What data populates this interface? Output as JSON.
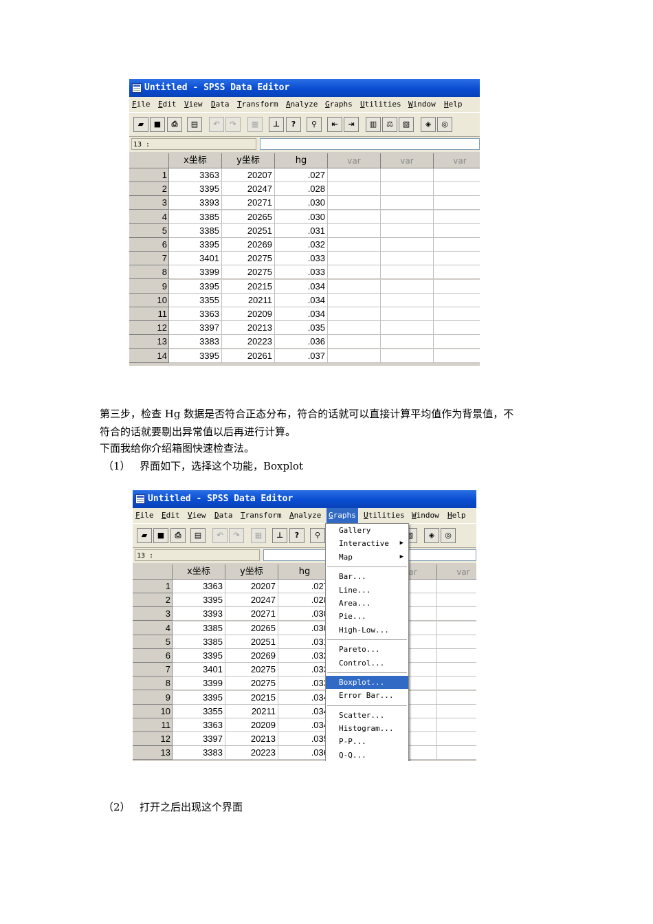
{
  "window": {
    "title": "Untitled - SPSS Data Editor"
  },
  "menu": [
    "File",
    "Edit",
    "View",
    "Data",
    "Transform",
    "Analyze",
    "Graphs",
    "Utilities",
    "Window",
    "Help"
  ],
  "cell_ref": "13 :",
  "columns": [
    "x坐标",
    "y坐标",
    "hg",
    "var",
    "var",
    "var"
  ],
  "rows": [
    [
      "1",
      "3363",
      "20207",
      ".027"
    ],
    [
      "2",
      "3395",
      "20247",
      ".028"
    ],
    [
      "3",
      "3393",
      "20271",
      ".030"
    ],
    [
      "4",
      "3385",
      "20265",
      ".030"
    ],
    [
      "5",
      "3385",
      "20251",
      ".031"
    ],
    [
      "6",
      "3395",
      "20269",
      ".032"
    ],
    [
      "7",
      "3401",
      "20275",
      ".033"
    ],
    [
      "8",
      "3399",
      "20275",
      ".033"
    ],
    [
      "9",
      "3395",
      "20215",
      ".034"
    ],
    [
      "10",
      "3355",
      "20211",
      ".034"
    ],
    [
      "11",
      "3363",
      "20209",
      ".034"
    ],
    [
      "12",
      "3397",
      "20213",
      ".035"
    ],
    [
      "13",
      "3383",
      "20223",
      ".036"
    ],
    [
      "14",
      "3395",
      "20261",
      ".037"
    ]
  ],
  "graphs_menu": [
    {
      "label": "Gallery"
    },
    {
      "label": "Interactive",
      "submenu": true
    },
    {
      "label": "Map",
      "submenu": true
    },
    {
      "separator": true
    },
    {
      "label": "Bar..."
    },
    {
      "label": "Line..."
    },
    {
      "label": "Area..."
    },
    {
      "label": "Pie..."
    },
    {
      "label": "High-Low..."
    },
    {
      "separator": true
    },
    {
      "label": "Pareto..."
    },
    {
      "label": "Control..."
    },
    {
      "separator": true
    },
    {
      "label": "Boxplot...",
      "selected": true
    },
    {
      "label": "Error Bar..."
    },
    {
      "separator": true
    },
    {
      "label": "Scatter..."
    },
    {
      "label": "Histogram..."
    },
    {
      "label": "P-P..."
    },
    {
      "label": "Q-Q..."
    }
  ],
  "text": {
    "step3_line1": "第三步，检查 Hg 数据是否符合正态分布，符合的话就可以直接计算平均值作为背景值，不",
    "step3_line2": "符合的话就要剔出异常值以后再进行计算。",
    "intro": "下面我给你介绍箱图快速检查法。",
    "item1_num": "（1）",
    "item1_text": "界面如下，选择这个功能，Boxplot",
    "item2_num": "（2）",
    "item2_text": "打开之后出现这个界面"
  }
}
